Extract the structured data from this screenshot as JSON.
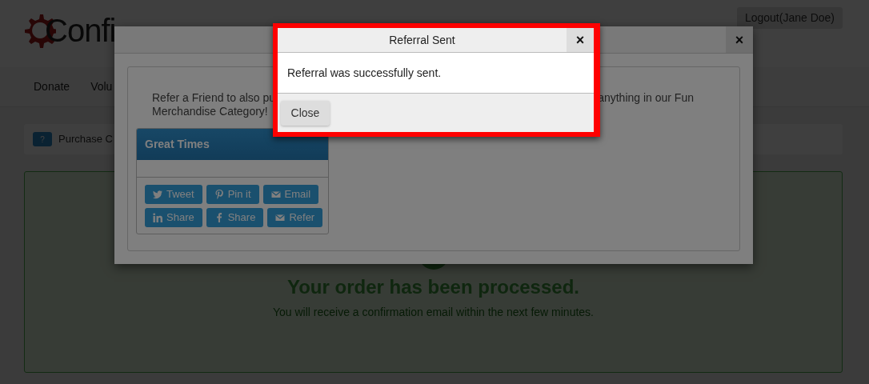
{
  "page": {
    "logo": "Confi",
    "logout_button": "Logout(Jane Doe)",
    "nav_items": [
      "Donate",
      "Volu"
    ],
    "breadcrumb": {
      "badge": "?",
      "text": "Purchase C"
    },
    "success": {
      "heading": "Your order has been processed.",
      "message": "You will receive a confirmation email within the next few minutes."
    }
  },
  "refer_modal": {
    "close": "×",
    "intro_fragments": [
      "Refer a Friend to also pu",
      "anything in our Fun",
      "Merchandise Category!"
    ],
    "card": {
      "title": "Great Times",
      "share_buttons": [
        {
          "kind": "twitter",
          "label": "Tweet"
        },
        {
          "kind": "pinterest",
          "label": "Pin it"
        },
        {
          "kind": "email",
          "label": "Email"
        },
        {
          "kind": "linkedin",
          "label": "Share"
        },
        {
          "kind": "facebook",
          "label": "Share"
        },
        {
          "kind": "email",
          "label": "Refer"
        }
      ]
    }
  },
  "alert_modal": {
    "title": "Referral Sent",
    "close": "×",
    "message": "Referral was successfully sent.",
    "button": "Close",
    "highlighted": true
  }
}
